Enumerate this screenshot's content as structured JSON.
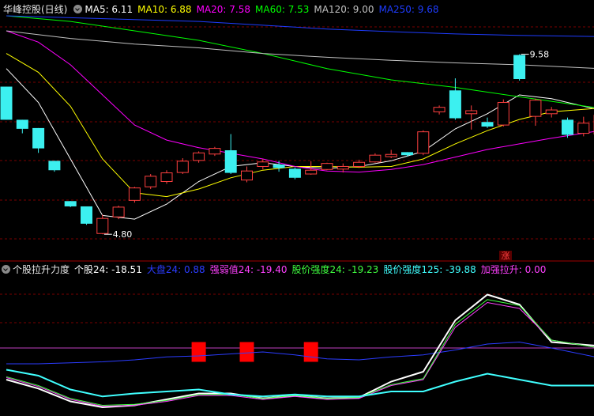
{
  "top_legend": {
    "title": "华峰控股(日线)",
    "items": [
      {
        "label": "MA5: 6.11",
        "color": "#ffffff"
      },
      {
        "label": "MA10: 6.88",
        "color": "#ffff00"
      },
      {
        "label": "MA20: 7.58",
        "color": "#ff00ff"
      },
      {
        "label": "MA60: 7.53",
        "color": "#00ff00"
      },
      {
        "label": "MA120: 9.00",
        "color": "#c0c0c0"
      },
      {
        "label": "MA250: 9.68",
        "color": "#1e3cff"
      }
    ]
  },
  "bottom_legend": {
    "title": "个股拉升力度",
    "items": [
      {
        "label": "个股24: -18.51",
        "color": "#ffffff"
      },
      {
        "label": "大盘24: 0.88",
        "color": "#2b3cff"
      },
      {
        "label": "强弱值24: -19.40",
        "color": "#ff40ff"
      },
      {
        "label": "股价强度24: -19.23",
        "color": "#40ff40"
      },
      {
        "label": "股价强度125: -39.88",
        "color": "#40ffff"
      },
      {
        "label": "加强拉升: 0.00",
        "color": "#ff40ff"
      }
    ]
  },
  "badge": "涨",
  "chart_data": [
    {
      "type": "candlestick",
      "y_range": [
        4.3,
        10.6
      ],
      "annotations": [
        {
          "text": "9.58",
          "value": 9.58,
          "index": 32
        },
        {
          "text": "4.80",
          "value": 4.8,
          "index": 6
        }
      ],
      "colors": {
        "up": "#ff4040",
        "down": "#3cf0f0"
      },
      "candles": [
        {
          "o": 8.72,
          "h": 8.72,
          "l": 7.84,
          "c": 7.84
        },
        {
          "o": 7.84,
          "h": 7.84,
          "l": 7.48,
          "c": 7.6
        },
        {
          "o": 7.62,
          "h": 7.62,
          "l": 6.96,
          "c": 7.08
        },
        {
          "o": 6.75,
          "h": 6.75,
          "l": 6.46,
          "c": 6.5
        },
        {
          "o": 5.68,
          "h": 5.68,
          "l": 5.52,
          "c": 5.54
        },
        {
          "o": 5.54,
          "h": 5.54,
          "l": 5.05,
          "c": 5.08
        },
        {
          "o": 4.82,
          "h": 5.32,
          "l": 4.8,
          "c": 5.22
        },
        {
          "o": 5.26,
          "h": 5.56,
          "l": 5.2,
          "c": 5.52
        },
        {
          "o": 5.7,
          "h": 6.06,
          "l": 5.64,
          "c": 6.03
        },
        {
          "o": 6.06,
          "h": 6.4,
          "l": 6.0,
          "c": 6.34
        },
        {
          "o": 6.2,
          "h": 6.5,
          "l": 6.14,
          "c": 6.43
        },
        {
          "o": 6.44,
          "h": 6.82,
          "l": 6.4,
          "c": 6.74
        },
        {
          "o": 6.76,
          "h": 7.0,
          "l": 6.7,
          "c": 6.96
        },
        {
          "o": 6.93,
          "h": 7.12,
          "l": 6.88,
          "c": 7.08
        },
        {
          "o": 7.03,
          "h": 7.46,
          "l": 6.4,
          "c": 6.43
        },
        {
          "o": 6.24,
          "h": 6.6,
          "l": 6.18,
          "c": 6.48
        },
        {
          "o": 6.6,
          "h": 6.8,
          "l": 6.52,
          "c": 6.72
        },
        {
          "o": 6.65,
          "h": 6.75,
          "l": 6.46,
          "c": 6.56
        },
        {
          "o": 6.54,
          "h": 6.58,
          "l": 6.26,
          "c": 6.3
        },
        {
          "o": 6.4,
          "h": 6.74,
          "l": 6.38,
          "c": 6.5
        },
        {
          "o": 6.52,
          "h": 6.7,
          "l": 6.5,
          "c": 6.68
        },
        {
          "o": 6.53,
          "h": 6.68,
          "l": 6.44,
          "c": 6.6
        },
        {
          "o": 6.6,
          "h": 6.78,
          "l": 6.56,
          "c": 6.71
        },
        {
          "o": 6.72,
          "h": 6.95,
          "l": 6.7,
          "c": 6.9
        },
        {
          "o": 6.86,
          "h": 7.04,
          "l": 6.82,
          "c": 6.92
        },
        {
          "o": 6.98,
          "h": 6.98,
          "l": 6.86,
          "c": 6.9
        },
        {
          "o": 6.95,
          "h": 7.56,
          "l": 6.9,
          "c": 7.52
        },
        {
          "o": 8.05,
          "h": 8.22,
          "l": 7.98,
          "c": 8.17
        },
        {
          "o": 8.62,
          "h": 8.94,
          "l": 7.84,
          "c": 7.88
        },
        {
          "o": 8.0,
          "h": 8.22,
          "l": 7.58,
          "c": 8.08
        },
        {
          "o": 7.78,
          "h": 7.9,
          "l": 7.62,
          "c": 7.66
        },
        {
          "o": 7.7,
          "h": 8.38,
          "l": 7.66,
          "c": 8.3
        },
        {
          "o": 9.56,
          "h": 9.58,
          "l": 8.88,
          "c": 8.92
        },
        {
          "o": 7.93,
          "h": 8.4,
          "l": 7.68,
          "c": 8.36
        },
        {
          "o": 8.0,
          "h": 8.18,
          "l": 7.9,
          "c": 8.1
        },
        {
          "o": 7.84,
          "h": 7.9,
          "l": 7.36,
          "c": 7.44
        },
        {
          "o": 7.48,
          "h": 7.92,
          "l": 7.4,
          "c": 7.75
        },
        {
          "o": 7.46,
          "h": 8.06,
          "l": 7.4,
          "c": 7.96
        }
      ],
      "ma_series": [
        {
          "name": "MA5",
          "color": "#ffffff",
          "x": [
            0,
            2,
            4,
            6,
            8,
            10,
            12,
            14,
            16,
            18,
            20,
            22,
            24,
            26,
            28,
            30,
            32,
            34,
            37
          ],
          "y": [
            9.2,
            8.3,
            6.8,
            5.3,
            5.2,
            5.6,
            6.2,
            6.6,
            6.7,
            6.6,
            6.55,
            6.6,
            6.75,
            7.0,
            7.6,
            8.0,
            8.5,
            8.4,
            8.1
          ]
        },
        {
          "name": "MA10",
          "color": "#ffff00",
          "x": [
            0,
            2,
            4,
            6,
            8,
            10,
            12,
            14,
            16,
            18,
            20,
            22,
            24,
            26,
            28,
            30,
            32,
            34,
            37
          ],
          "y": [
            9.6,
            9.1,
            8.2,
            6.8,
            5.9,
            5.8,
            6.0,
            6.3,
            6.5,
            6.6,
            6.6,
            6.58,
            6.6,
            6.8,
            7.2,
            7.55,
            7.85,
            8.05,
            8.15
          ]
        },
        {
          "name": "MA20",
          "color": "#ff00ff",
          "x": [
            0,
            2,
            4,
            6,
            8,
            10,
            12,
            14,
            16,
            18,
            20,
            22,
            24,
            26,
            28,
            30,
            32,
            34,
            37
          ],
          "y": [
            10.2,
            9.9,
            9.3,
            8.5,
            7.7,
            7.3,
            7.1,
            6.95,
            6.8,
            6.6,
            6.48,
            6.45,
            6.52,
            6.65,
            6.85,
            7.05,
            7.2,
            7.35,
            7.55
          ]
        },
        {
          "name": "MA60",
          "color": "#00ff00",
          "x": [
            0,
            4,
            8,
            12,
            16,
            20,
            24,
            28,
            32,
            37
          ],
          "y": [
            10.6,
            10.45,
            10.2,
            9.95,
            9.6,
            9.2,
            8.9,
            8.7,
            8.45,
            8.15
          ]
        },
        {
          "name": "MA120",
          "color": "#c0c0c0",
          "x": [
            0,
            4,
            8,
            12,
            16,
            20,
            24,
            28,
            32,
            37
          ],
          "y": [
            10.2,
            10.0,
            9.85,
            9.75,
            9.6,
            9.5,
            9.42,
            9.35,
            9.3,
            9.2
          ]
        },
        {
          "name": "MA250",
          "color": "#1e3cff",
          "x": [
            0,
            4,
            8,
            12,
            16,
            20,
            24,
            28,
            32,
            37
          ],
          "y": [
            10.6,
            10.55,
            10.5,
            10.45,
            10.35,
            10.25,
            10.18,
            10.12,
            10.08,
            10.05
          ]
        }
      ]
    },
    {
      "type": "line",
      "y_range": [
        -50,
        90
      ],
      "bars": [
        {
          "index": 12,
          "value": 20,
          "color": "#ff0000"
        },
        {
          "index": 15,
          "value": 20,
          "color": "#ff0000"
        },
        {
          "index": 19,
          "value": 20,
          "color": "#ff0000"
        }
      ],
      "series": [
        {
          "name": "大盘24",
          "color": "#2b3cff",
          "x": [
            0,
            2,
            4,
            6,
            8,
            10,
            12,
            14,
            16,
            18,
            20,
            22,
            24,
            26,
            28,
            30,
            32,
            34,
            37
          ],
          "y": [
            -2,
            -2,
            -1,
            0,
            2,
            5,
            6,
            8,
            10,
            7,
            3,
            2,
            5,
            7,
            12,
            18,
            20,
            14,
            4
          ]
        },
        {
          "name": "个股24",
          "color": "#ffffff",
          "x": [
            0,
            2,
            4,
            6,
            8,
            10,
            12,
            14,
            16,
            18,
            20,
            22,
            24,
            26,
            28,
            30,
            32,
            34,
            37
          ],
          "y": [
            -18,
            -27,
            -40,
            -46,
            -44,
            -38,
            -32,
            -32,
            -37,
            -34,
            -37,
            -36,
            -20,
            -10,
            42,
            68,
            58,
            20,
            16
          ]
        },
        {
          "name": "强弱值24",
          "color": "#ff40ff",
          "x": [
            0,
            2,
            4,
            6,
            8,
            10,
            12,
            14,
            16,
            18,
            20,
            22,
            24,
            26,
            28,
            30,
            32,
            34,
            37
          ],
          "y": [
            -16,
            -25,
            -38,
            -45,
            -44,
            -40,
            -34,
            -34,
            -38,
            -35,
            -38,
            -37,
            -24,
            -18,
            35,
            60,
            54,
            22,
            14
          ]
        },
        {
          "name": "股价强度24",
          "color": "#40ff40",
          "x": [
            0,
            2,
            4,
            6,
            8,
            10,
            12,
            14,
            16,
            18,
            20,
            22,
            24,
            26,
            28,
            30,
            32,
            34,
            37
          ],
          "y": [
            -15,
            -24,
            -37,
            -44,
            -43,
            -39,
            -33,
            -33,
            -37,
            -34,
            -37,
            -36,
            -23,
            -17,
            38,
            63,
            57,
            22,
            14
          ]
        },
        {
          "name": "股价强度125",
          "color": "#40ffff",
          "x": [
            0,
            2,
            4,
            6,
            8,
            10,
            12,
            14,
            16,
            18,
            20,
            22,
            24,
            26,
            28,
            30,
            32,
            34,
            37
          ],
          "y": [
            -8,
            -14,
            -28,
            -35,
            -32,
            -30,
            -28,
            -33,
            -35,
            -33,
            -35,
            -35,
            -30,
            -30,
            -20,
            -12,
            -18,
            -24,
            -24
          ]
        }
      ]
    }
  ]
}
